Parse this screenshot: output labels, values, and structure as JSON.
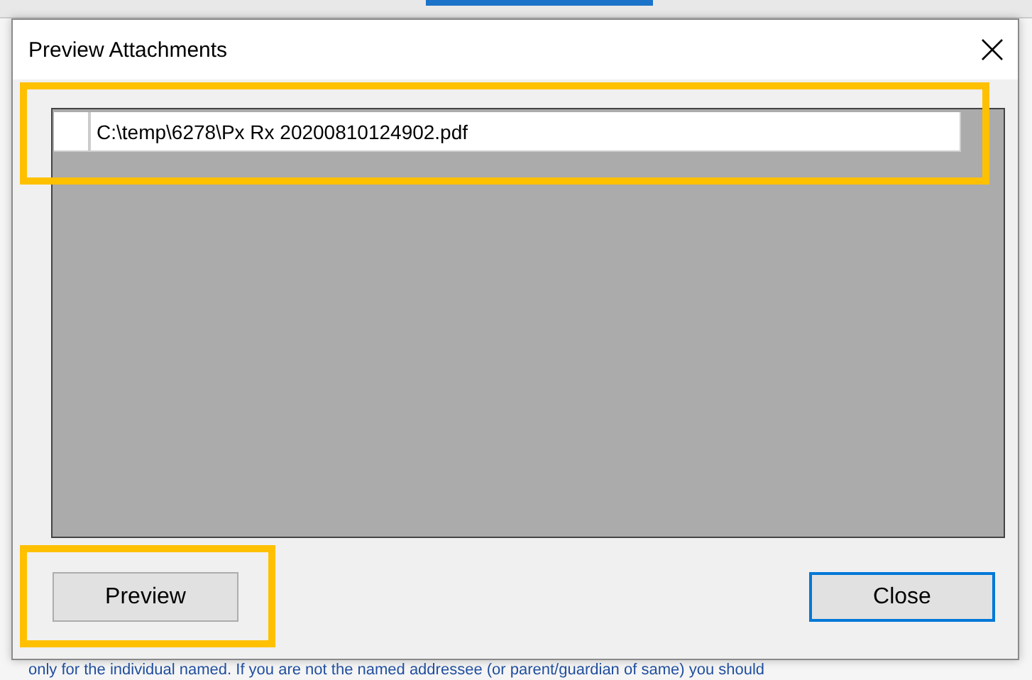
{
  "window": {
    "title": "Preview Attachments"
  },
  "attachments": [
    {
      "path": "C:\\temp\\6278\\Px Rx 20200810124902.pdf"
    }
  ],
  "buttons": [
    {
      "label": "Preview",
      "focused": false
    },
    {
      "label": "Close",
      "focused": true
    }
  ],
  "background_text": "only for the individual named. If you are not the named addressee (or parent/guardian of same) you should"
}
